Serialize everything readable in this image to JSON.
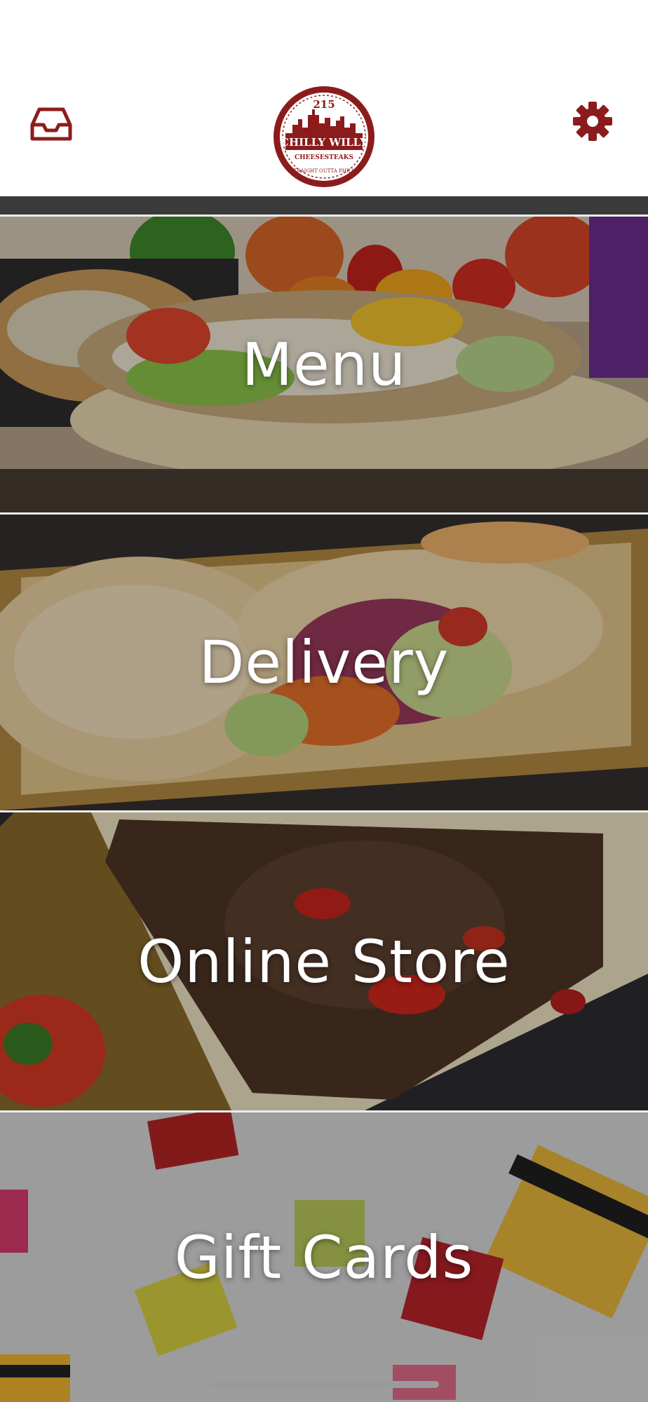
{
  "header": {
    "logo": {
      "top_number": "215",
      "name": "CHILLY WILLY",
      "subtitle": "CHEESESTEAKS",
      "tagline": "STRAIGHT OUTTA PHILLY"
    },
    "inbox_icon": "inbox-icon",
    "settings_icon": "gear-icon"
  },
  "tiles": [
    {
      "label": "Menu"
    },
    {
      "label": "Delivery"
    },
    {
      "label": "Online Store"
    },
    {
      "label": "Gift Cards"
    }
  ],
  "colors": {
    "brand": "#8c1c1c",
    "label_text": "#ffffff"
  }
}
